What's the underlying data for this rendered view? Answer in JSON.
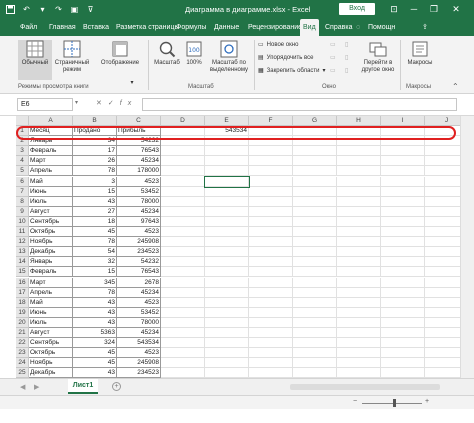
{
  "window": {
    "title": "Диаграмма в диаграмме.xlsx - Excel",
    "signin_label": "Вход",
    "min_icon": "minimize-icon",
    "restore_icon": "restore-icon",
    "close_icon": "close-icon"
  },
  "tabs": [
    {
      "label": "Файл",
      "active": false
    },
    {
      "label": "Главная",
      "active": false
    },
    {
      "label": "Вставка",
      "active": false
    },
    {
      "label": "Разметка страницы",
      "active": false
    },
    {
      "label": "Формулы",
      "active": false
    },
    {
      "label": "Данные",
      "active": false
    },
    {
      "label": "Рецензирование",
      "active": false
    },
    {
      "label": "Вид",
      "active": true
    },
    {
      "label": "Справка",
      "active": false
    }
  ],
  "tabs_right": {
    "help": "Помощн",
    "share": ""
  },
  "ribbon": {
    "normal": "Обычный",
    "page_mode_1": "Страничный",
    "page_mode_2": "режим",
    "show": "Отображение",
    "zoom": "Масштаб",
    "zoom100": "100%",
    "zoom_sel_1": "Масштаб по",
    "zoom_sel_2": "выделенному",
    "new_window": "Новое окно",
    "arrange_all": "Упорядочить все",
    "freeze": "Закрепить области",
    "switch_1": "Перейти в",
    "switch_2": "другое окно",
    "macros": "Макросы",
    "group_views": "Режимы просмотра книги",
    "group_zoom": "Масштаб",
    "group_window": "Окно",
    "group_macros": "Макросы"
  },
  "formula_bar": {
    "name_box": "E6",
    "value": ""
  },
  "grid": {
    "columns": [
      "A",
      "B",
      "C",
      "D",
      "E",
      "F",
      "G",
      "H",
      "I",
      "J",
      "K"
    ],
    "rows": [
      [
        "Месяц",
        "Продано",
        "Прибыль",
        "",
        "543534"
      ],
      [
        "Январь",
        "34",
        "54232",
        "",
        ""
      ],
      [
        "Февраль",
        "17",
        "76543",
        "",
        ""
      ],
      [
        "Март",
        "26",
        "45234",
        "",
        ""
      ],
      [
        "Апрель",
        "78",
        "178000",
        "",
        ""
      ],
      [
        "Май",
        "3",
        "4523",
        "",
        ""
      ],
      [
        "Июнь",
        "15",
        "53452",
        "",
        ""
      ],
      [
        "Июль",
        "43",
        "78000",
        "",
        ""
      ],
      [
        "Август",
        "27",
        "45234",
        "",
        ""
      ],
      [
        "Сентябрь",
        "18",
        "97643",
        "",
        ""
      ],
      [
        "Октябрь",
        "45",
        "4523",
        "",
        ""
      ],
      [
        "Ноябрь",
        "78",
        "245908",
        "",
        ""
      ],
      [
        "Декабрь",
        "54",
        "234523",
        "",
        ""
      ],
      [
        "Январь",
        "32",
        "54232",
        "",
        ""
      ],
      [
        "Февраль",
        "15",
        "76543",
        "",
        ""
      ],
      [
        "Март",
        "345",
        "2678",
        "",
        ""
      ],
      [
        "Апрель",
        "78",
        "45234",
        "",
        ""
      ],
      [
        "Май",
        "43",
        "4523",
        "",
        ""
      ],
      [
        "Июнь",
        "43",
        "53452",
        "",
        ""
      ],
      [
        "Июль",
        "43",
        "78000",
        "",
        ""
      ],
      [
        "Август",
        "5363",
        "45234",
        "",
        ""
      ],
      [
        "Сентябрь",
        "324",
        "543534",
        "",
        ""
      ],
      [
        "Октябрь",
        "45",
        "4523",
        "",
        ""
      ],
      [
        "Ноябрь",
        "45",
        "245908",
        "",
        ""
      ],
      [
        "Декабрь",
        "43",
        "234523",
        "",
        ""
      ]
    ]
  },
  "sheets": [
    {
      "label": "Лист1",
      "active": true
    }
  ],
  "status": {
    "zoom_minus": "−",
    "zoom_plus": "+"
  }
}
